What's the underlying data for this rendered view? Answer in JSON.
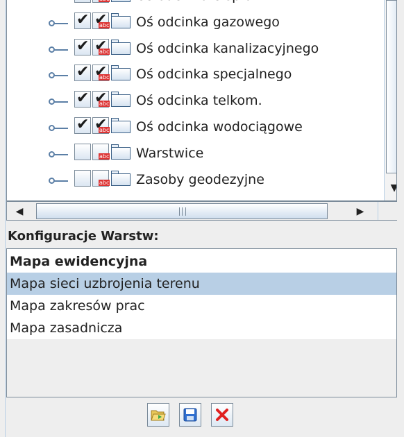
{
  "tree": {
    "items": [
      {
        "label": "Oś odcinka ciepłown.",
        "visible": true,
        "labels": true
      },
      {
        "label": "Oś odcinka gazowego",
        "visible": true,
        "labels": true
      },
      {
        "label": "Oś odcinka kanalizacyjnego",
        "visible": true,
        "labels": true
      },
      {
        "label": "Oś odcinka specjalnego",
        "visible": true,
        "labels": true
      },
      {
        "label": "Oś odcinka telkom.",
        "visible": true,
        "labels": true
      },
      {
        "label": "Oś odcinka wodociągowe",
        "visible": true,
        "labels": true
      },
      {
        "label": "Warstwice",
        "visible": false,
        "labels": false
      },
      {
        "label": "Zasoby geodezyjne",
        "visible": false,
        "labels": false
      }
    ],
    "check_glyph": "✔",
    "abc_glyph": "abc"
  },
  "scrollbars": {
    "down_arrow": "▼",
    "left_arrow": "◀",
    "right_arrow": "▶"
  },
  "config": {
    "heading": "Konfiguracje Warstw:",
    "items": [
      {
        "label": "Mapa ewidencyjna",
        "bold": true,
        "selected": false
      },
      {
        "label": "Mapa sieci uzbrojenia terenu",
        "bold": false,
        "selected": true
      },
      {
        "label": "Mapa zakresów prac",
        "bold": false,
        "selected": false
      },
      {
        "label": "Mapa zasadnicza",
        "bold": false,
        "selected": false
      }
    ]
  },
  "toolbar": {
    "buttons": [
      {
        "icon": "folder-open-icon"
      },
      {
        "icon": "save-icon"
      },
      {
        "icon": "delete-icon"
      }
    ]
  },
  "colors": {
    "selection": "#b8cfe5",
    "delete_red": "#e02020",
    "save_blue": "#2f6fd0"
  }
}
